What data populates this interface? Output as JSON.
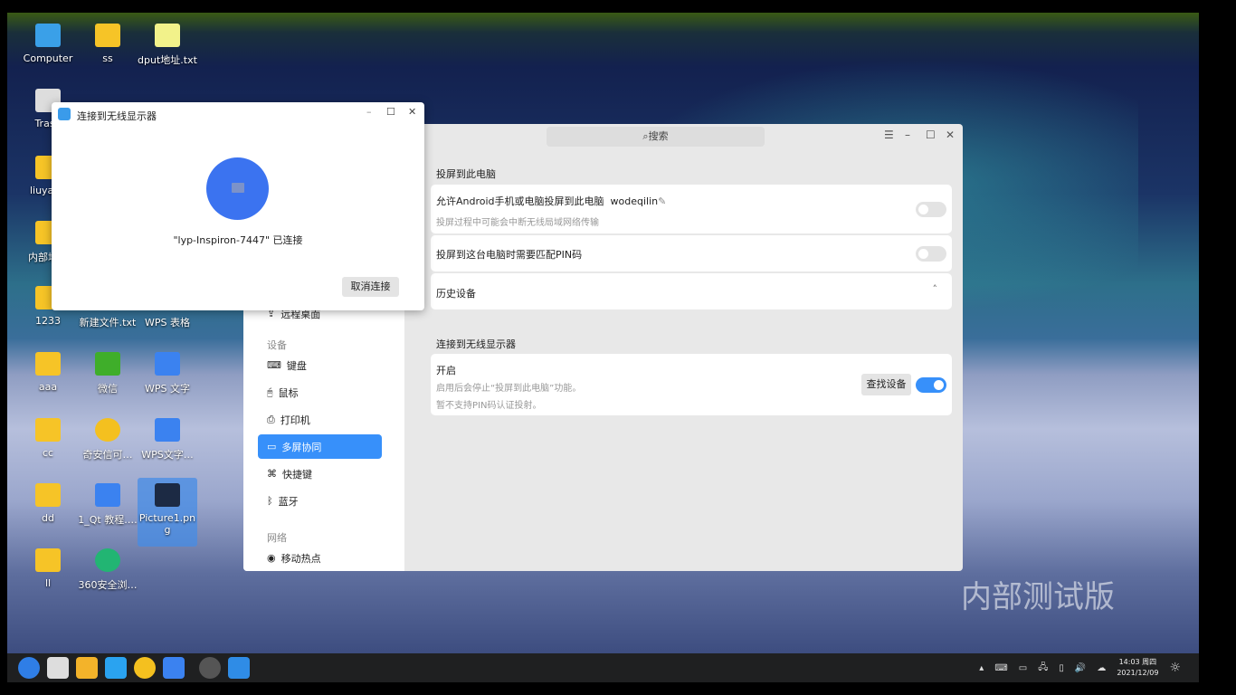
{
  "desktop": {
    "icons": [
      {
        "label": "Computer",
        "kind": "computer"
      },
      {
        "label": "ss",
        "kind": "folder"
      },
      {
        "label": "dput地址.txt",
        "kind": "text"
      },
      {
        "label": "Trash",
        "kind": "trash"
      },
      {
        "label": "liuyape",
        "kind": "home"
      },
      {
        "label": "内部培训",
        "kind": "folder"
      },
      {
        "label": "1233",
        "kind": "folder"
      },
      {
        "label": "新建文件.txt",
        "kind": "text"
      },
      {
        "label": "WPS 表格",
        "kind": "wps"
      },
      {
        "label": "aaa",
        "kind": "folder"
      },
      {
        "label": "微信",
        "kind": "wechat"
      },
      {
        "label": "WPS 文字",
        "kind": "wps"
      },
      {
        "label": "cc",
        "kind": "folder"
      },
      {
        "label": "奇安信可…",
        "kind": "browser"
      },
      {
        "label": "WPS文字…",
        "kind": "wps"
      },
      {
        "label": "dd",
        "kind": "folder"
      },
      {
        "label": "1_Qt 教程.…",
        "kind": "wps"
      },
      {
        "label": "Picture1.png",
        "kind": "image"
      },
      {
        "label": "ll",
        "kind": "folder"
      },
      {
        "label": "360安全浏…",
        "kind": "browser360"
      }
    ],
    "watermark": "内部测试版"
  },
  "dialog": {
    "title": "连接到无线显示器",
    "status": "\"lyp-Inspiron-7447\" 已连接",
    "cancel": "取消连接"
  },
  "settings": {
    "search": "搜索",
    "sidebar": {
      "hidden_item": "远程桌面",
      "group_device": "设备",
      "items": [
        "键盘",
        "鼠标",
        "打印机",
        "多屏协同",
        "快捷键",
        "蓝牙"
      ],
      "group_network": "网络",
      "network_items": [
        "移动热点"
      ],
      "active": "多屏协同"
    },
    "project": {
      "title": "投屏到此电脑",
      "allow": "允许Android手机或电脑投屏到此电脑",
      "name": "wodeqilin",
      "allow_hint": "投屏过程中可能会中断无线局域网络传输",
      "allow_on": false,
      "pin": "投屏到这台电脑时需要匹配PIN码",
      "pin_on": false,
      "history": "历史设备"
    },
    "wireless": {
      "title": "连接到无线显示器",
      "enable": "开启",
      "hint1": "启用后会停止“投屏到此电脑”功能。",
      "hint2": "暂不支持PIN码认证投射。",
      "find": "查找设备",
      "on": true
    }
  },
  "taskbar": {
    "time": "14:03 周四",
    "date": "2021/12/09"
  }
}
